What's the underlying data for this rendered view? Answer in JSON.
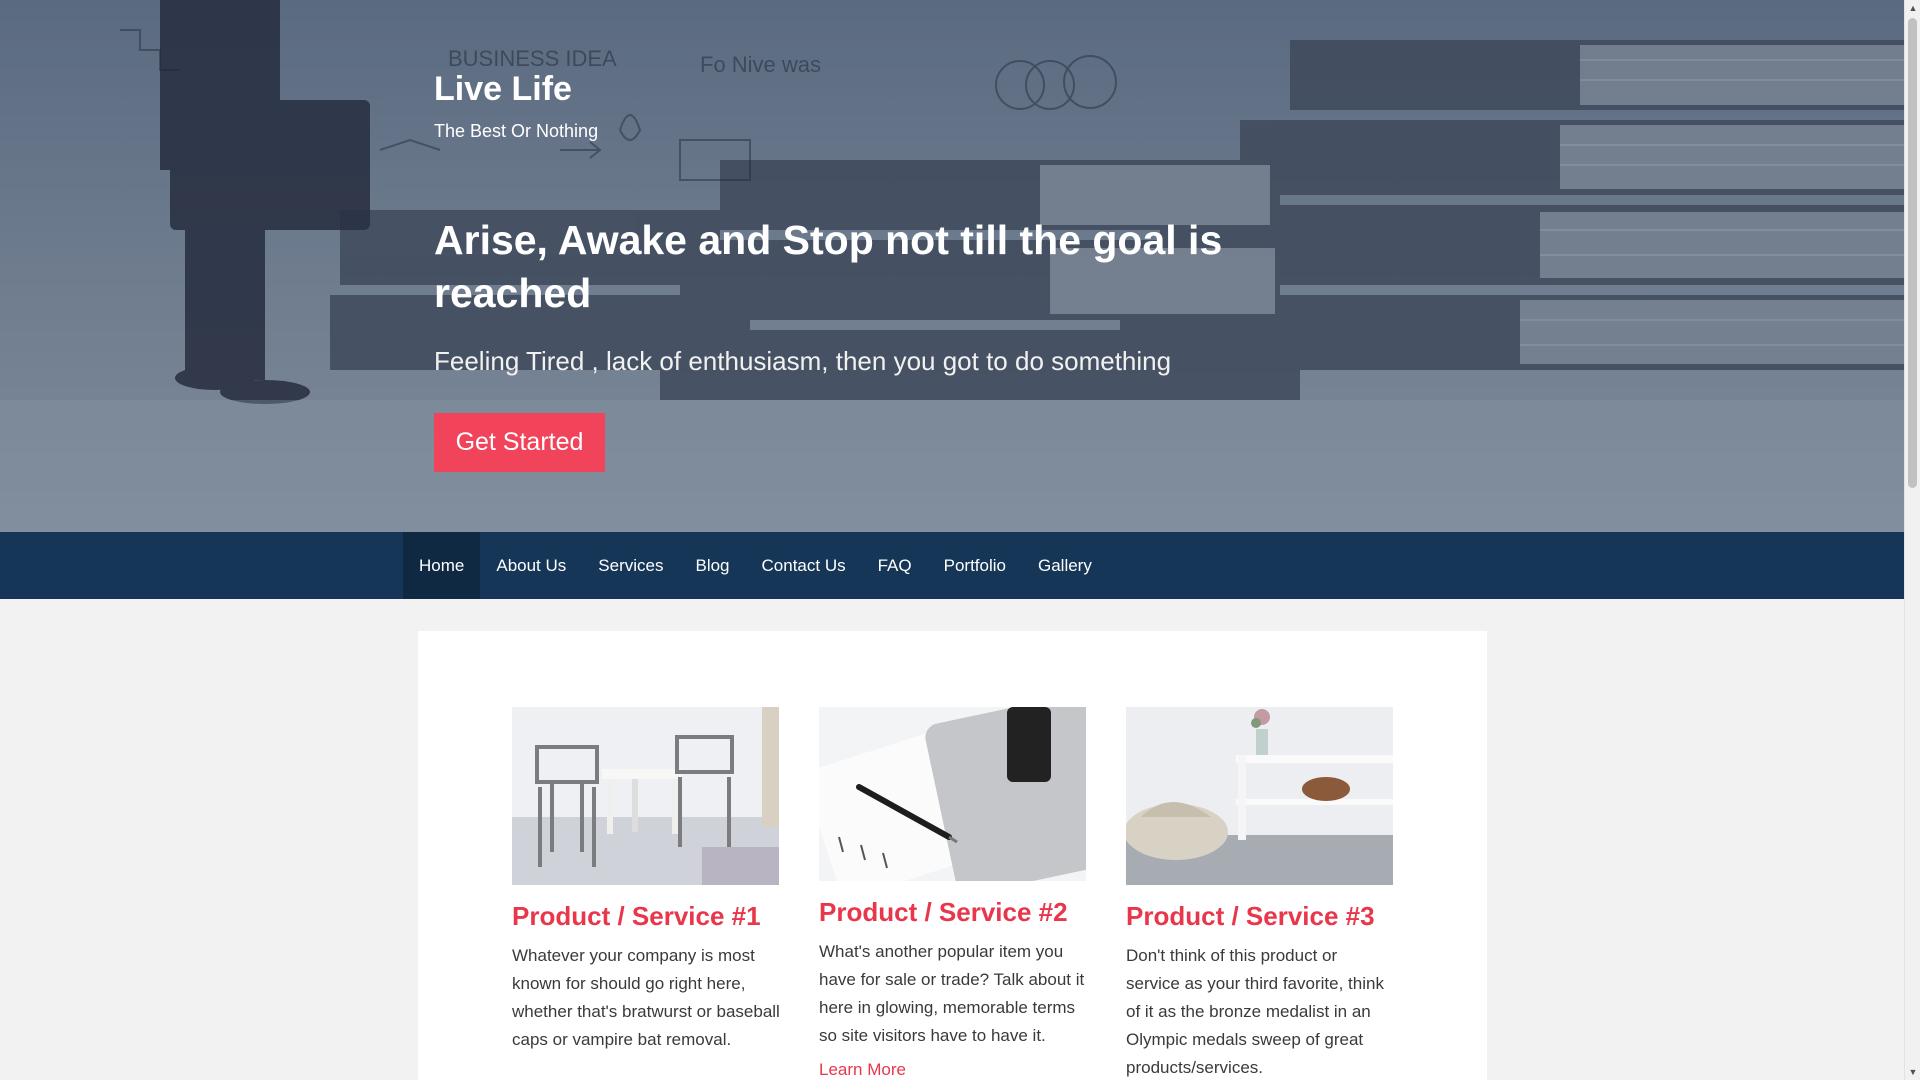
{
  "hero": {
    "site_title": "Live Life",
    "tagline": "The Best Or Nothing",
    "headline": "Arise, Awake and Stop not till the goal is reached",
    "subheadline": "Feeling Tired , lack of enthusiasm, then you got to do something",
    "cta_label": "Get Started",
    "doodle_labels": {
      "business_idea": "BUSINESS IDEA",
      "scribble": "Fo Nive was"
    }
  },
  "nav": {
    "items": [
      {
        "label": "Home",
        "active": true
      },
      {
        "label": "About Us",
        "active": false
      },
      {
        "label": "Services",
        "active": false
      },
      {
        "label": "Blog",
        "active": false
      },
      {
        "label": "Contact Us",
        "active": false
      },
      {
        "label": "FAQ",
        "active": false
      },
      {
        "label": "Portfolio",
        "active": false
      },
      {
        "label": "Gallery",
        "active": false
      }
    ]
  },
  "products": [
    {
      "title": "Product / Service #1",
      "description": "Whatever your company is most known for should go right here, whether that's bratwurst or baseball caps or vampire bat removal.",
      "image": "chairs-table-photo"
    },
    {
      "title": "Product / Service #2",
      "description": "What's another popular item you have for sale or trade? Talk about it here in glowing, memorable terms so site visitors have to have it.",
      "link_label": "Learn More",
      "image": "tablet-pen-photo"
    },
    {
      "title": "Product / Service #3",
      "description": "Don't think of this product or service as your third favorite, think of it as the bronze medalist in an Olympic medals sweep of great products/services.",
      "image": "shelf-basket-photo"
    }
  ],
  "colors": {
    "accent": "#e8374b",
    "cta": "#f1435a",
    "nav_bg": "#163657",
    "nav_active": "#0f2942",
    "hero_overlay": "#5a6a80"
  }
}
